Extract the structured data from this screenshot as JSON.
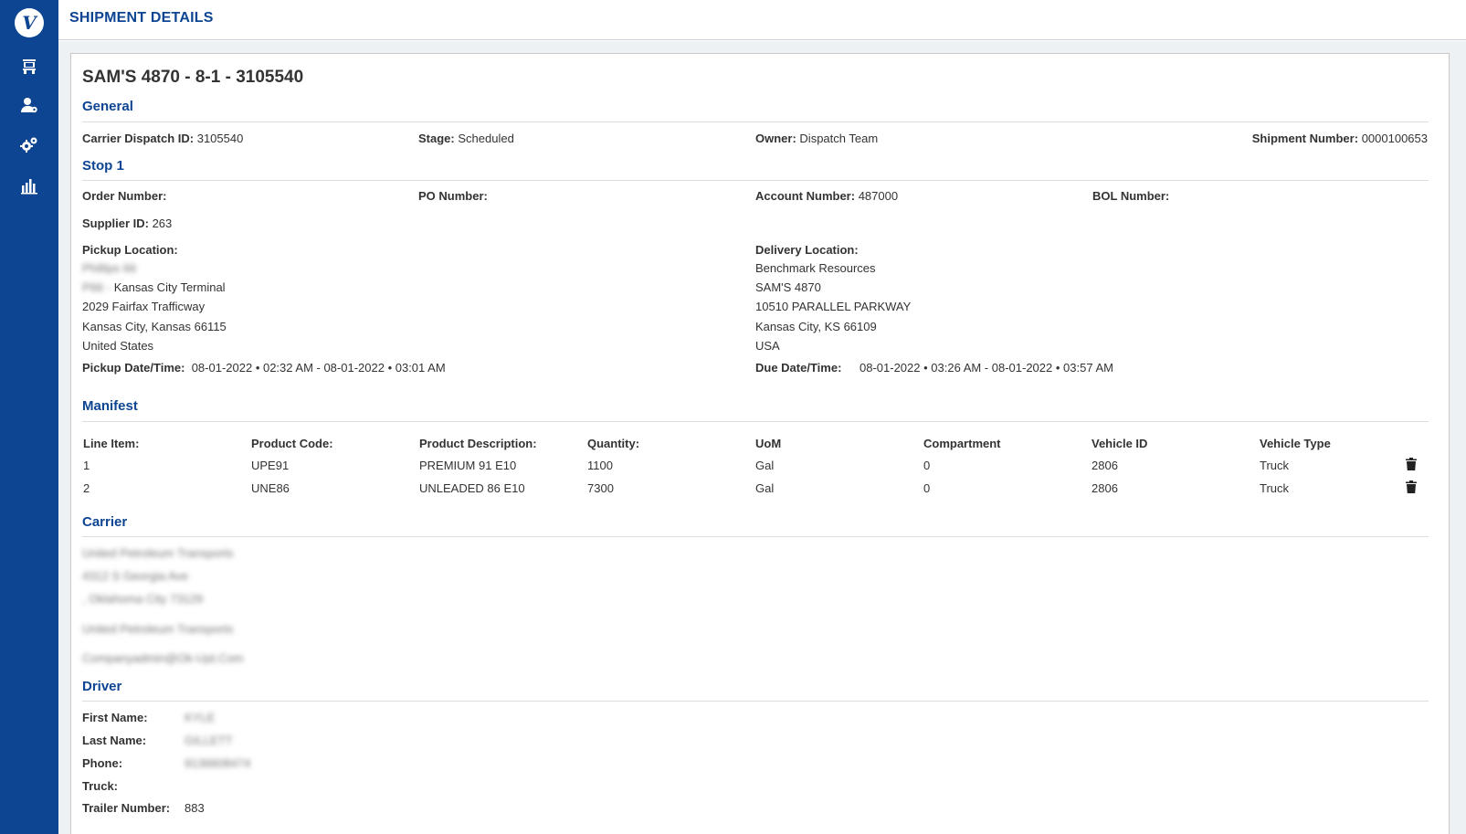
{
  "app": {
    "logo_text": "V"
  },
  "sidebar": {
    "items": [
      {
        "name": "truck-icon"
      },
      {
        "name": "user-settings-icon"
      },
      {
        "name": "gears-icon"
      },
      {
        "name": "bar-chart-icon"
      }
    ]
  },
  "header": {
    "title": "SHIPMENT DETAILS"
  },
  "shipment": {
    "title": "SAM'S 4870 - 8-1 - 3105540",
    "general": {
      "heading": "General",
      "carrier_dispatch_label": "Carrier Dispatch ID:",
      "carrier_dispatch_value": "3105540",
      "stage_label": "Stage:",
      "stage_value": "Scheduled",
      "owner_label": "Owner:",
      "owner_value": "Dispatch Team",
      "shipment_number_label": "Shipment Number:",
      "shipment_number_value": "0000100653"
    },
    "stop": {
      "heading": "Stop 1",
      "order_number_label": "Order Number:",
      "order_number_value": "",
      "po_number_label": "PO Number:",
      "po_number_value": "",
      "account_number_label": "Account Number:",
      "account_number_value": "487000",
      "bol_number_label": "BOL Number:",
      "bol_number_value": "",
      "supplier_id_label": "Supplier ID:",
      "supplier_id_value": "263",
      "pickup": {
        "label": "Pickup Location:",
        "line1": "Phillips 66",
        "line2_prefix": "P66 -",
        "line2": "Kansas City Terminal",
        "line3": "2029 Fairfax Trafficway",
        "line4": "Kansas City, Kansas 66115",
        "line5": "United States",
        "datetime_label": "Pickup Date/Time:",
        "datetime_value": "08-01-2022 • 02:32 AM - 08-01-2022 • 03:01 AM"
      },
      "delivery": {
        "label": "Delivery Location:",
        "line1": "Benchmark Resources",
        "line2": "SAM'S 4870",
        "line3": "10510 PARALLEL PARKWAY",
        "line4": "Kansas City, KS 66109",
        "line5": "USA",
        "datetime_label": "Due Date/Time:",
        "datetime_value": "08-01-2022 • 03:26 AM - 08-01-2022 • 03:57 AM"
      }
    },
    "manifest": {
      "heading": "Manifest",
      "columns": [
        "Line Item:",
        "Product Code:",
        "Product Description:",
        "Quantity:",
        "UoM",
        "Compartment",
        "Vehicle ID",
        "Vehicle Type"
      ],
      "rows": [
        [
          "1",
          "UPE91",
          "PREMIUM 91 E10",
          "1100",
          "Gal",
          "0",
          "2806",
          "Truck"
        ],
        [
          "2",
          "UNE86",
          "UNLEADED 86 E10",
          "7300",
          "Gal",
          "0",
          "2806",
          "Truck"
        ]
      ]
    },
    "carrier": {
      "heading": "Carrier",
      "name": "United Petroleum Transports",
      "address1": "4312 S Georgia Ave",
      "address2": ", Oklahoma City 73129",
      "name2": "United Petroleum Transports",
      "email": "Companyadmin@Ok-Upt.Com"
    },
    "driver": {
      "heading": "Driver",
      "first_name_label": "First Name:",
      "first_name_value": "KYLE",
      "last_name_label": "Last Name:",
      "last_name_value": "GILLETT",
      "phone_label": "Phone:",
      "phone_value": "9136608474",
      "truck_label": "Truck:",
      "truck_value": "",
      "trailer_label": "Trailer Number:",
      "trailer_value": "883"
    }
  }
}
